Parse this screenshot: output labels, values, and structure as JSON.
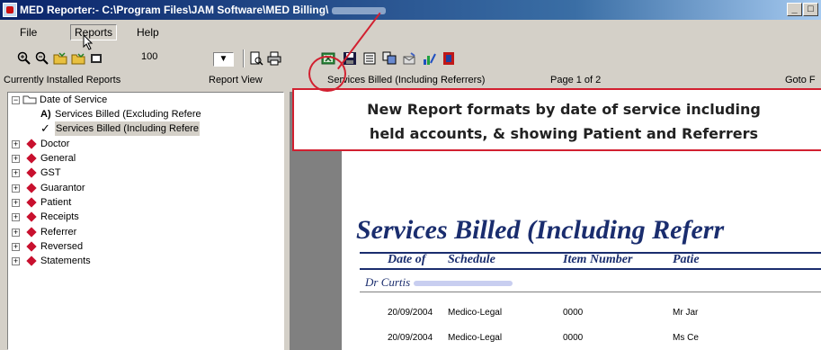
{
  "window": {
    "title": "MED Reporter:- C:\\Program Files\\JAM Software\\MED Billing\\"
  },
  "menu": {
    "file": "File",
    "reports": "Reports",
    "help": "Help"
  },
  "toolbar": {
    "zoom": "100"
  },
  "labels": {
    "installed": "Currently Installed Reports",
    "view": "Report View",
    "report_name": "Services Billed (Including Referrers)",
    "page": "Page 1 of 2",
    "goto": "Goto F"
  },
  "tree": {
    "root": "Date of Service",
    "children": [
      "Services Billed (Excluding Refere",
      "Services Billed (Including Refere"
    ],
    "categories": [
      "Doctor",
      "General",
      "GST",
      "Guarantor",
      "Patient",
      "Receipts",
      "Referrer",
      "Reversed",
      "Statements"
    ]
  },
  "annotation": {
    "line1": "New Report formats by date of service including",
    "line2": "held accounts, & showing Patient and Referrers"
  },
  "report": {
    "title": "Services Billed (Including Referr",
    "columns": [
      "Date of",
      "Schedule",
      "Item Number",
      "Patie"
    ],
    "doctor": "Dr Curtis",
    "rows": [
      {
        "date": "20/09/2004",
        "schedule": "Medico-Legal",
        "item": "0000",
        "patient": "Mr Jar"
      },
      {
        "date": "20/09/2004",
        "schedule": "Medico-Legal",
        "item": "0000",
        "patient": "Ms Ce"
      }
    ]
  },
  "colors": {
    "accent": "#d22030",
    "report_blue": "#1a2d6e"
  }
}
